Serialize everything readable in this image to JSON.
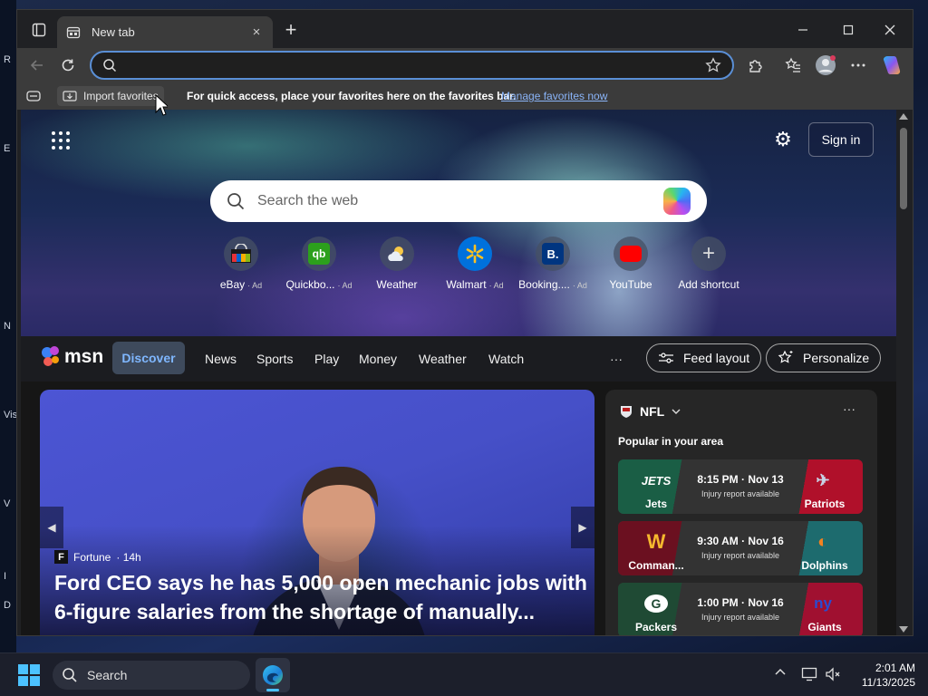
{
  "browser": {
    "tab": {
      "title": "New tab",
      "close": "×"
    },
    "new_tab": "+",
    "address": {
      "value": "",
      "placeholder": ""
    },
    "favorites_bar": {
      "import": "Import favorites",
      "message": "For quick access, place your favorites here on the favorites bar.",
      "link": "Manage favorites now"
    }
  },
  "ntp": {
    "signin": "Sign in",
    "search_placeholder": "Search the web",
    "shortcuts": [
      {
        "label": "eBay",
        "ad": "· Ad"
      },
      {
        "label": "Quickbo...",
        "ad": "· Ad"
      },
      {
        "label": "Weather",
        "ad": ""
      },
      {
        "label": "Walmart",
        "ad": "· Ad"
      },
      {
        "label": "Booking....",
        "ad": "· Ad"
      },
      {
        "label": "YouTube",
        "ad": ""
      },
      {
        "label": "Add shortcut",
        "ad": ""
      }
    ],
    "msn": {
      "logo": "msn",
      "discover": "Discover",
      "nav": [
        "News",
        "Sports",
        "Play",
        "Money",
        "Weather",
        "Watch"
      ],
      "more": "···",
      "feed_layout": "Feed layout",
      "personalize": "Personalize"
    },
    "hero_card": {
      "source": "Fortune",
      "age": "· 14h",
      "headline": "Ford CEO says he has 5,000 open mechanic jobs with 6-figure salaries from the shortage of manually..."
    },
    "nfl": {
      "title": "NFL",
      "more": "···",
      "subtitle": "Popular in your area",
      "games": [
        {
          "home": "Jets",
          "away": "Patriots",
          "time": "8:15 PM · Nov 13",
          "note": "Injury report available",
          "home_color": "#1a5e45",
          "away_color": "#b0102a"
        },
        {
          "home": "Comman...",
          "away": "Dolphins",
          "time": "9:30 AM · Nov 16",
          "note": "Injury report available",
          "home_color": "#6b1020",
          "away_color": "#1d6b6e"
        },
        {
          "home": "Packers",
          "away": "Giants",
          "time": "1:00 PM · Nov 16",
          "note": "Injury report available",
          "home_color": "#1f4a34",
          "away_color": "#a01030"
        }
      ]
    }
  },
  "taskbar": {
    "search": "Search",
    "time": "2:01 AM",
    "date": "11/13/2025"
  },
  "desktop": {
    "left_labels": [
      "R",
      "E",
      "N",
      "Vis",
      "V",
      "I",
      "D"
    ]
  },
  "colors": {
    "accent": "#5a8fd6",
    "link": "#8ab4f8",
    "discover": "#7fb7ff"
  }
}
